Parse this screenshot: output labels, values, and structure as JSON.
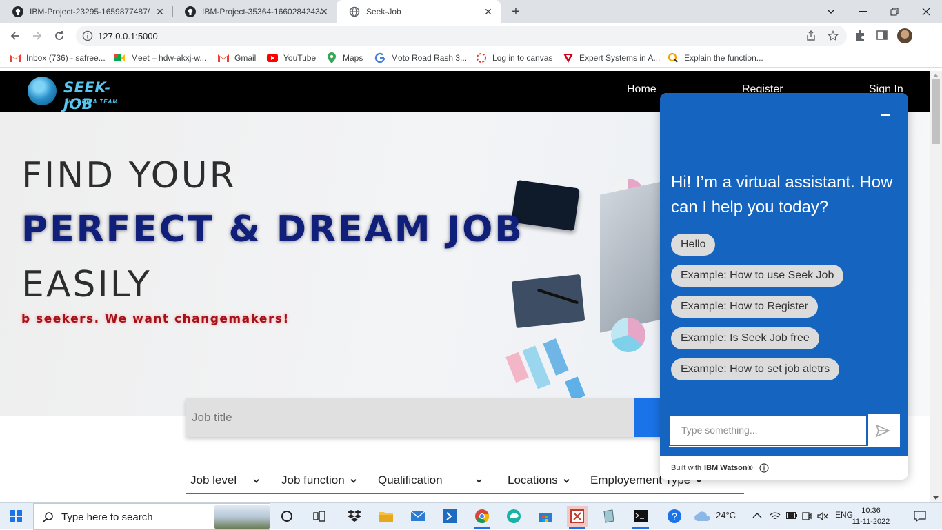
{
  "browser": {
    "tabs": [
      {
        "title": "IBM-Project-23295-1659877487/",
        "icon": "github-icon",
        "active": false
      },
      {
        "title": "IBM-Project-35364-1660284243/",
        "icon": "github-icon",
        "active": false
      },
      {
        "title": "Seek-Job",
        "icon": "globe-icon",
        "active": true
      }
    ],
    "url": "127.0.0.1:5000",
    "bookmarks": [
      {
        "label": "Inbox (736) - safree...",
        "icon": "gmail-icon"
      },
      {
        "label": "Meet – hdw-akxj-w...",
        "icon": "meet-icon"
      },
      {
        "label": "Gmail",
        "icon": "gmail-icon"
      },
      {
        "label": "YouTube",
        "icon": "youtube-icon"
      },
      {
        "label": "Maps",
        "icon": "maps-icon"
      },
      {
        "label": "Moto Road Rash 3...",
        "icon": "g-icon"
      },
      {
        "label": "Log in to canvas",
        "icon": "canvas-icon"
      },
      {
        "label": "Expert Systems in A...",
        "icon": "expert-icon"
      },
      {
        "label": "Explain the function...",
        "icon": "search-g-icon"
      }
    ]
  },
  "site": {
    "logo_name": "SEEK-JOB",
    "logo_tag": "WE ARE A TEAM",
    "nav": [
      "Home",
      "Register",
      "Sign In"
    ],
    "hero": {
      "line1": "FIND YOUR",
      "line2": "PERFECT & DREAM JOB",
      "line3": "EASILY",
      "marquee": "b seekers. We want changemakers!"
    },
    "search": {
      "placeholder": "Job title"
    },
    "filters": [
      "Job level",
      "Job function",
      "Qualification",
      "Locations",
      "Employement Type"
    ]
  },
  "chat": {
    "greeting": "Hi! I’m a virtual assistant. How can I help you today?",
    "chips": [
      "Hello",
      "Example: How to use Seek Job",
      "Example: How to Register",
      "Example: Is Seek Job free",
      "Example: How to set job aletrs"
    ],
    "input_placeholder": "Type something...",
    "footer_prefix": "Built with",
    "footer_brand": "IBM Watson®",
    "accent": "#1565c0"
  },
  "taskbar": {
    "search_text": "Type here to search",
    "weather": "24°C",
    "lang": "ENG",
    "time": "10:36",
    "date": "11-11-2022"
  }
}
